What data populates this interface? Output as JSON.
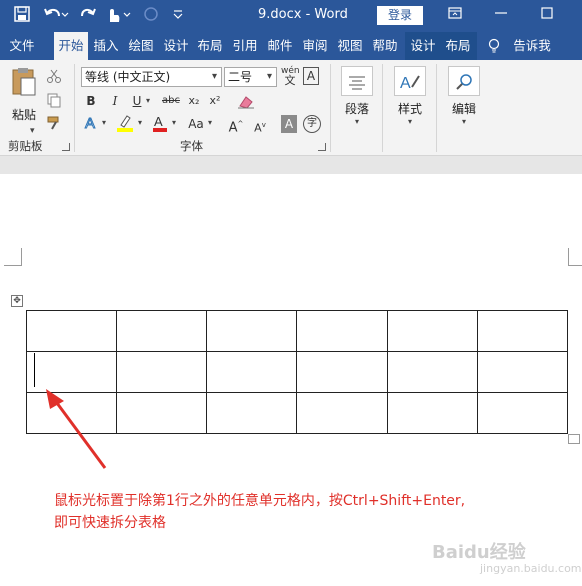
{
  "title_bar": {
    "title": "9.docx  -  Word",
    "login_label": "登录"
  },
  "tabs": [
    {
      "label": "文件"
    },
    {
      "label": "开始"
    },
    {
      "label": "插入"
    },
    {
      "label": "绘图"
    },
    {
      "label": "设计"
    },
    {
      "label": "布局"
    },
    {
      "label": "引用"
    },
    {
      "label": "邮件"
    },
    {
      "label": "审阅"
    },
    {
      "label": "视图"
    },
    {
      "label": "帮助"
    },
    {
      "label": "设计"
    },
    {
      "label": "布局"
    },
    {
      "label": "告诉我"
    }
  ],
  "ribbon": {
    "clipboard": {
      "paste_label": "粘贴",
      "group_label": "剪贴板"
    },
    "font": {
      "font_name": "等线 (中文正文)",
      "font_size": "二号",
      "group_label": "字体",
      "bold": "B",
      "italic": "I",
      "underline": "U",
      "strike": "abc",
      "subscript": "x₂",
      "superscript": "x²",
      "case": "Aa",
      "grow": "A",
      "shrink": "A",
      "wen": "wén"
    },
    "paragraph": {
      "label": "段落"
    },
    "styles": {
      "label": "样式"
    },
    "editing": {
      "label": "编辑"
    }
  },
  "annotation": {
    "line1": "鼠标光标置于除第1行之外的任意单元格内，按Ctrl+Shift+Enter,",
    "line2": "即可快速拆分表格"
  },
  "watermark": {
    "text": "Baidu经验",
    "sub": "jingyan.baidu.com"
  },
  "colors": {
    "title_bar": "#2b579a",
    "ribbon_bg": "#f3f3f3",
    "annotation": "#e0302a"
  }
}
